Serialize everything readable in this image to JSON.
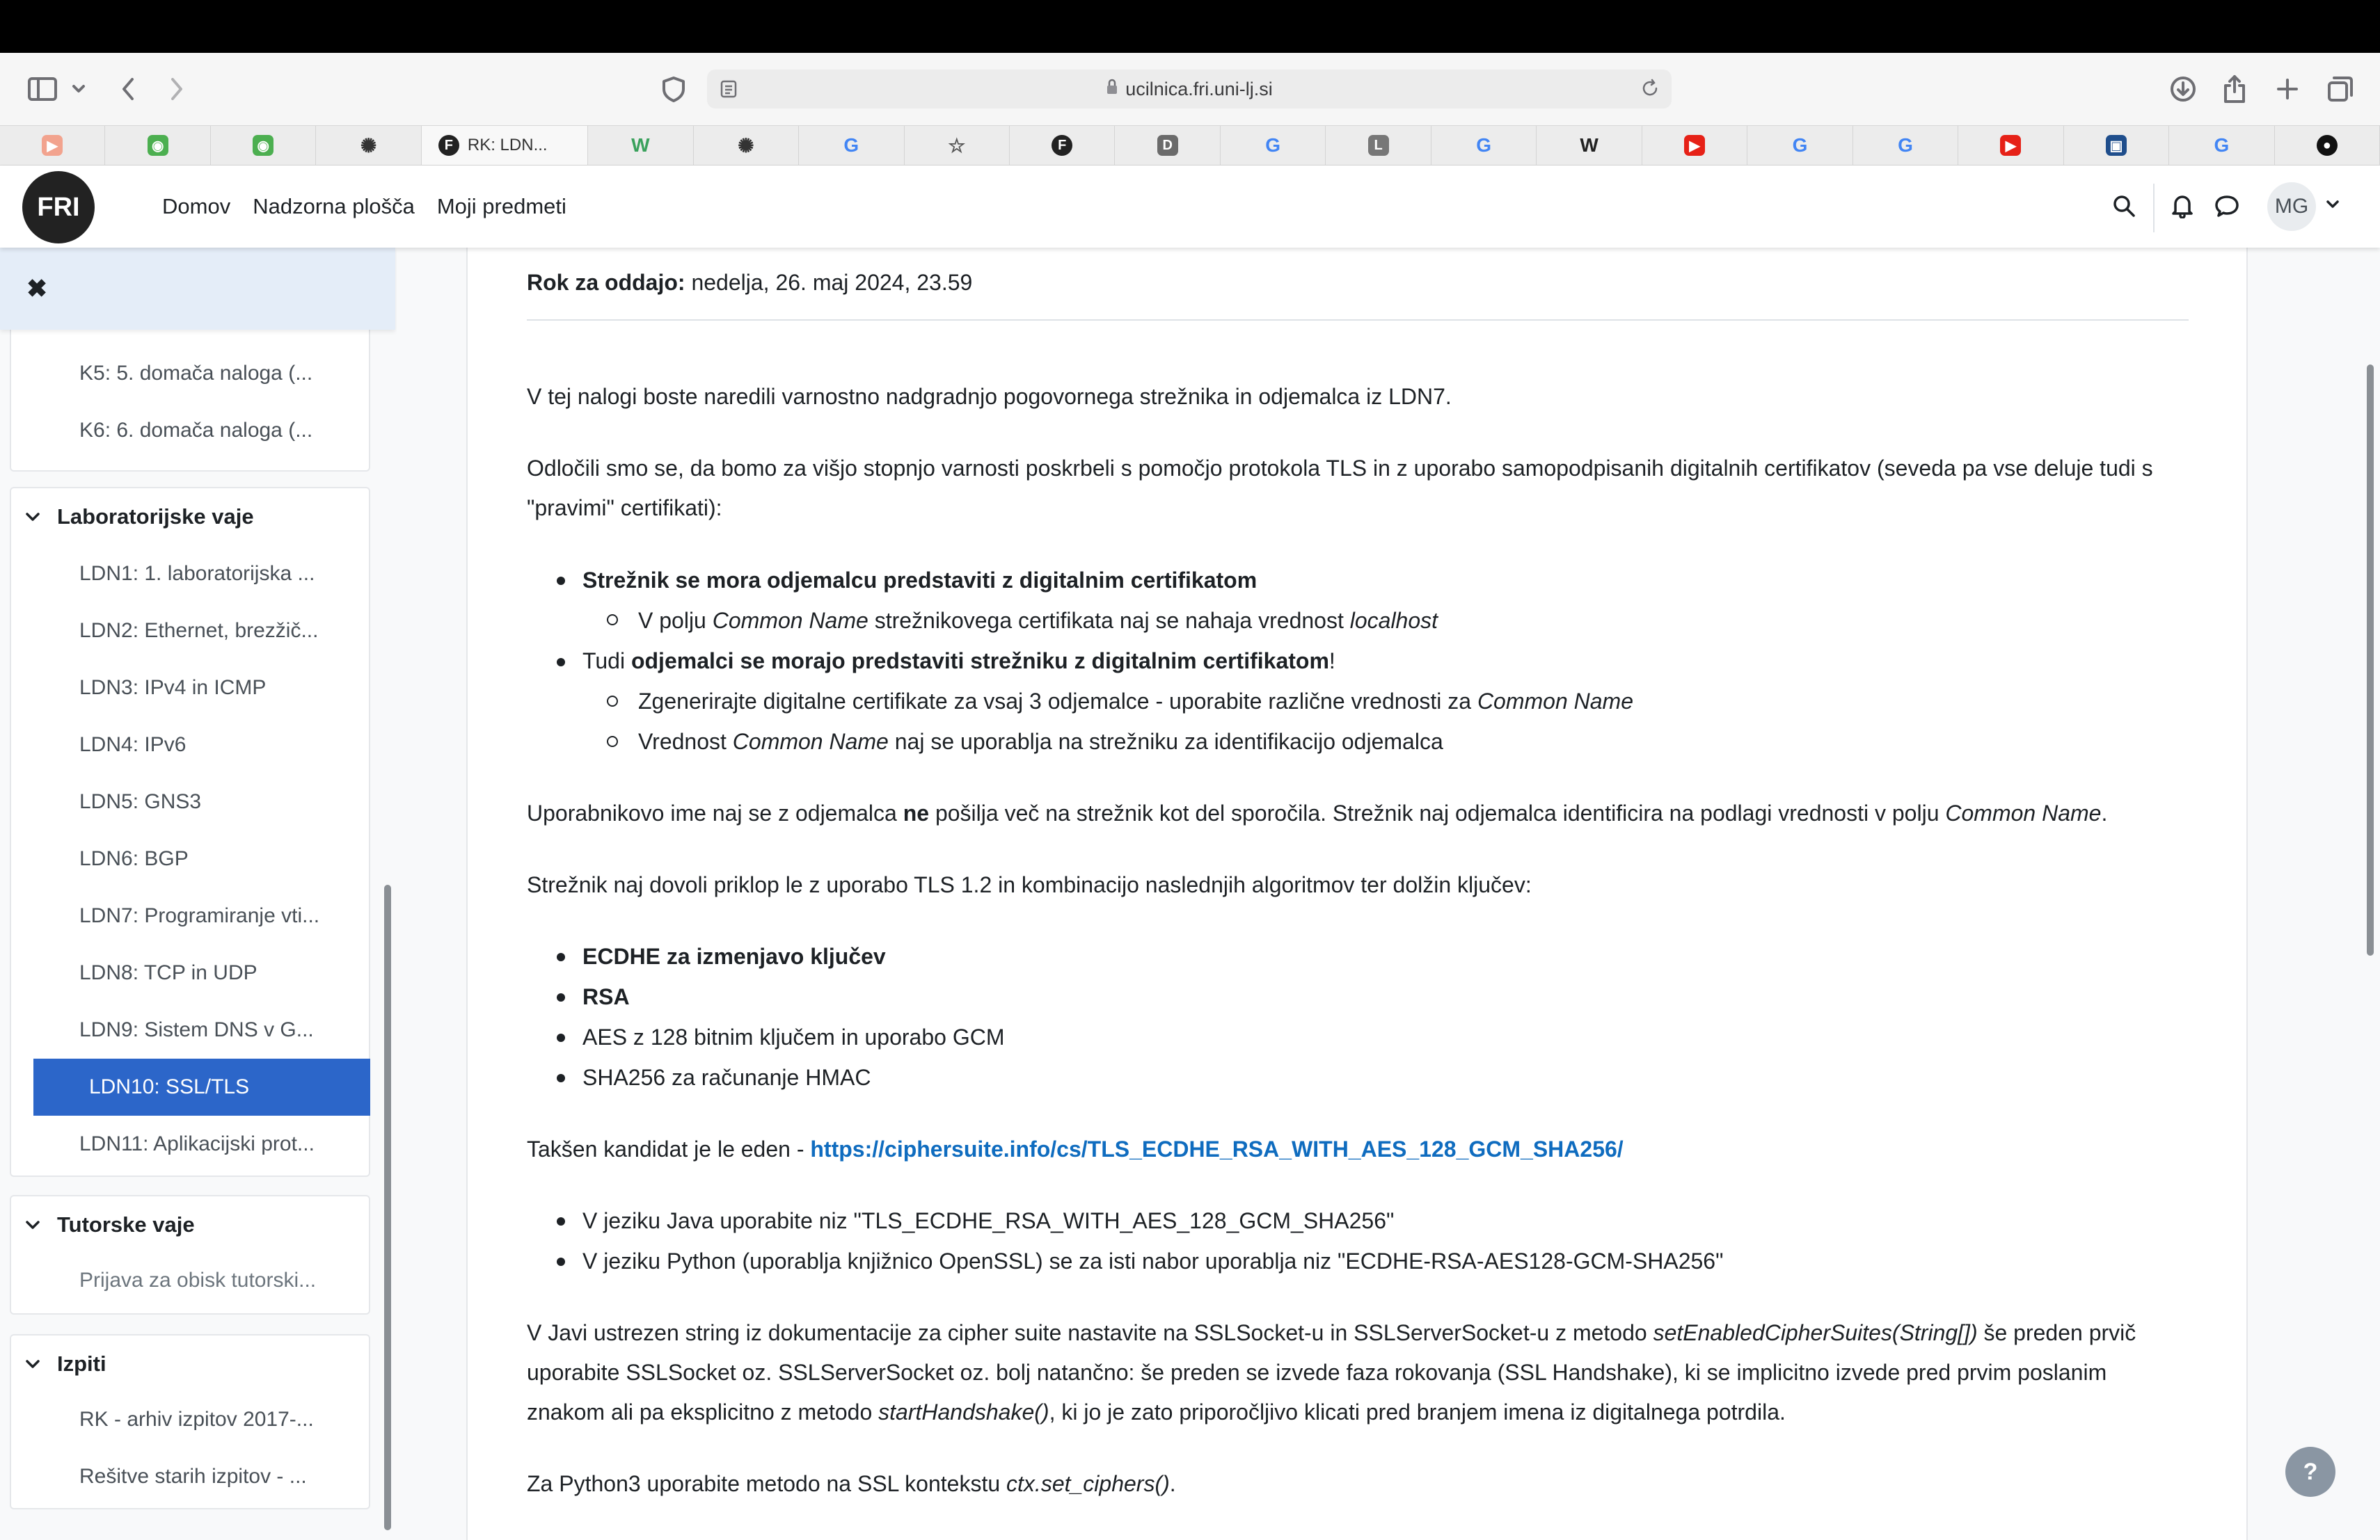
{
  "browser": {
    "url": "ucilnica.fri.uni-lj.si",
    "active_tab_title": "RK: LDN...",
    "tabs": [
      {
        "icon": "video-favicon",
        "color": "#f2a38e",
        "glyph": "▶"
      },
      {
        "icon": "owl-favicon",
        "color": "#4caf50",
        "glyph": "◉"
      },
      {
        "icon": "owl-favicon",
        "color": "#4caf50",
        "glyph": "◉"
      },
      {
        "icon": "openai-favicon",
        "color": "#333333",
        "glyph": "✺"
      },
      {
        "icon": "fri-favicon",
        "color": "#222222",
        "glyph": "F",
        "active": true
      },
      {
        "icon": "w-favicon",
        "color": "#3aa15c",
        "glyph": "W"
      },
      {
        "icon": "openai-favicon",
        "color": "#333333",
        "glyph": "✺"
      },
      {
        "icon": "google-favicon",
        "color": "#4285f4",
        "glyph": "G"
      },
      {
        "icon": "star-favicon",
        "color": "#555555",
        "glyph": "☆"
      },
      {
        "icon": "fri-favicon",
        "color": "#222222",
        "glyph": "F"
      },
      {
        "icon": "d-favicon",
        "color": "#6b6b6b",
        "glyph": "D"
      },
      {
        "icon": "google-favicon",
        "color": "#4285f4",
        "glyph": "G"
      },
      {
        "icon": "l-favicon",
        "color": "#777777",
        "glyph": "L"
      },
      {
        "icon": "google-favicon",
        "color": "#4285f4",
        "glyph": "G"
      },
      {
        "icon": "wikipedia-favicon",
        "color": "#222222",
        "glyph": "W"
      },
      {
        "icon": "youtube-favicon",
        "color": "#e62117",
        "glyph": "▶"
      },
      {
        "icon": "google-favicon",
        "color": "#4285f4",
        "glyph": "G"
      },
      {
        "icon": "google-favicon",
        "color": "#4285f4",
        "glyph": "G"
      },
      {
        "icon": "youtube-favicon",
        "color": "#e62117",
        "glyph": "▶"
      },
      {
        "icon": "monitor-favicon",
        "color": "#1f4e8c",
        "glyph": "▣"
      },
      {
        "icon": "google-favicon",
        "color": "#4285f4",
        "glyph": "G"
      },
      {
        "icon": "github-favicon",
        "color": "#111111",
        "glyph": "●"
      }
    ]
  },
  "header": {
    "logo": "FRI",
    "nav": [
      "Domov",
      "Nadzorna plošča",
      "Moji predmeti"
    ],
    "avatar_initials": "MG"
  },
  "drawer": {
    "close_glyph": "✖",
    "top_items": [
      "K5: 5. domača naloga (...",
      "K6: 6. domača naloga (..."
    ],
    "sections": [
      {
        "title": "Laboratorijske vaje",
        "items": [
          "LDN1: 1. laboratorijska ...",
          "LDN2: Ethernet, brezžič...",
          "LDN3: IPv4 in ICMP",
          "LDN4: IPv6",
          "LDN5: GNS3",
          "LDN6: BGP",
          "LDN7: Programiranje vti...",
          "LDN8: TCP in UDP",
          "LDN9: Sistem DNS v G...",
          "LDN10: SSL/TLS",
          "LDN11: Aplikacijski prot..."
        ],
        "active_index": 9
      },
      {
        "title": "Tutorske vaje",
        "items": [
          "Prijava za obisk tutorski..."
        ]
      },
      {
        "title": "Izpiti",
        "items": [
          "RK - arhiv izpitov 2017-...",
          "Rešitve starih izpitov - ..."
        ]
      }
    ]
  },
  "content": {
    "due_label": "Rok za oddajo:",
    "due_value": " nedelja, 26. maj 2024, 23.59",
    "p1": "V tej nalogi boste naredili varnostno nadgradnjo pogovornega strežnika in odjemalca iz LDN7.",
    "p2_line1": "Odločili smo se, da bomo za višjo stopnjo varnosti poskrbeli s pomočjo protokola TLS in z uporabo samopodpisanih digitalnih certifikatov (seveda pa vse deluje tudi s",
    "p2_line2": "\"pravimi\" certifikati):",
    "req1": "Strežnik se mora odjemalcu predstaviti z digitalnim certifikatom",
    "req1_sub_a": "V polju ",
    "req1_sub_b": "Common Name",
    "req1_sub_c": " strežnikovega certifikata naj se nahaja vrednost ",
    "req1_sub_d": "localhost",
    "req2_a": "Tudi ",
    "req2_b": "odjemalci se morajo predstaviti strežniku z digitalnim certifikatom",
    "req2_c": "!",
    "req2_sub1_a": "Zgenerirajte digitalne certifikate za vsaj 3 odjemalce - uporabite različne vrednosti za ",
    "req2_sub1_b": "Common Name",
    "req2_sub2_a": "Vrednost ",
    "req2_sub2_b": "Common Name",
    "req2_sub2_c": " naj se uporablja na strežniku za identifikacijo odjemalca",
    "p3_a": "Uporabnikovo ime naj se z odjemalca ",
    "p3_b": "ne",
    "p3_c": " pošilja več na strežnik kot del sporočila. Strežnik naj odjemalca identificira na podlagi vrednosti v polju ",
    "p3_d": "Common Name",
    "p3_e": ".",
    "p4": "Strežnik naj dovoli priklop le z uporabo TLS 1.2 in kombinacijo naslednjih algoritmov ter dolžin ključev:",
    "algs": [
      "ECDHE za izmenjavo ključev",
      "RSA",
      "AES z 128 bitnim ključem in uporabo GCM",
      "SHA256 za računanje HMAC"
    ],
    "p5_a": "Takšen kandidat je le eden - ",
    "p5_link": "https://ciphersuite.info/cs/TLS_ECDHE_RSA_WITH_AES_128_GCM_SHA256/",
    "lang1": "V jeziku Java uporabite niz \"TLS_ECDHE_RSA_WITH_AES_128_GCM_SHA256\"",
    "lang2": "V jeziku Python (uporablja knjižnico OpenSSL) se za isti nabor uporablja niz \"ECDHE-RSA-AES128-GCM-SHA256\"",
    "p6_l1_a": "V Javi ustrezen string iz dokumentacije za cipher suite nastavite na SSLSocket-u in SSLServerSocket-u z metodo ",
    "p6_l1_b": "setEnabledCipherSuites(String[])",
    "p6_l1_c": " še preden prvič",
    "p6_l2": "uporabite SSLSocket oz. SSLServerSocket oz. bolj natančno: še preden se izvede faza rokovanja (SSL Handshake), ki se implicitno izvede pred prvim poslanim",
    "p6_l3_a": "znakom ali pa eksplicitno z metodo ",
    "p6_l3_b": "startHandshake()",
    "p6_l3_c": ", ki jo je zato priporočljivo klicati pred branjem imena iz digitalnega potrdila.",
    "p7_a": "Za Python3 uporabite metodo na SSL kontekstu ",
    "p7_b": "ctx.set_ciphers()",
    "p7_c": "."
  },
  "help_label": "?"
}
